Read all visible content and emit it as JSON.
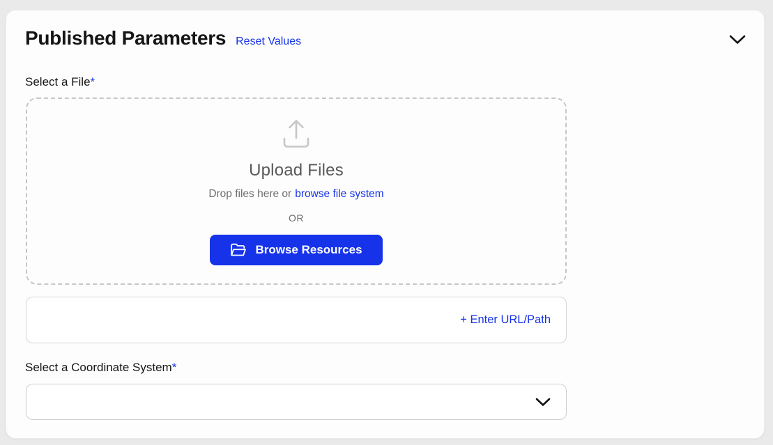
{
  "panel": {
    "title": "Published Parameters",
    "reset_values_label": "Reset Values",
    "collapse_icon": "chevron-down"
  },
  "file_section": {
    "label": "Select a File",
    "required_marker": "*",
    "dropzone": {
      "upload_icon": "upload-arrow-tray-icon",
      "title": "Upload Files",
      "drop_text": "Drop files here or",
      "browse_link_label": "browse file system",
      "or_text": "OR",
      "browse_resources_button": {
        "icon": "open-folder-icon",
        "label": "Browse Resources"
      }
    },
    "url_entry": {
      "link_label": "+ Enter URL/Path",
      "value": ""
    }
  },
  "coordinate_section": {
    "label": "Select a Coordinate System",
    "required_marker": "*",
    "selected_value": "",
    "dropdown_icon": "chevron-down"
  },
  "colors": {
    "accent_blue": "#1633ea",
    "page_background": "#eaeaea",
    "card_background": "#fdfdfd",
    "muted_text": "#6d6e70",
    "dropzone_title_text": "#58595b"
  }
}
